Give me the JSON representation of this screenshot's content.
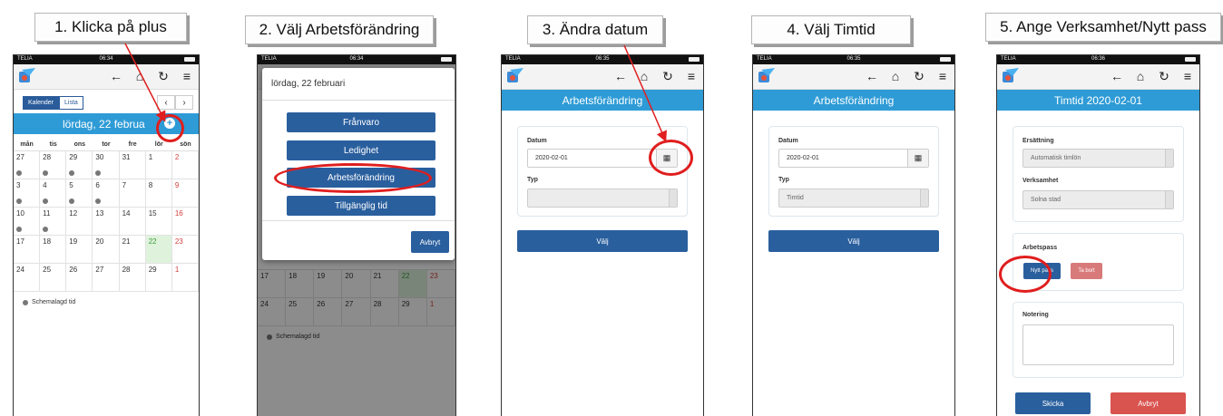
{
  "captions": [
    "1. Klicka på plus",
    "2. Välj Arbetsförändring",
    "3. Ändra datum",
    "4. Välj Timtid",
    "5. Ange Verksamhet/Nytt pass"
  ],
  "status": {
    "carrier": "TELIA",
    "times": [
      "06:34",
      "06:34",
      "06:35",
      "06:35",
      "06:36"
    ]
  },
  "nav_icons": {
    "back": "←",
    "home": "⌂",
    "refresh": "↻",
    "menu": "≡"
  },
  "screen1": {
    "view_tabs": [
      "Kalender",
      "Lista"
    ],
    "prev": "‹",
    "next": "›",
    "date_header": "lördag, 22 februa",
    "plus": "+",
    "weekdays": [
      "mån",
      "tis",
      "ons",
      "tor",
      "fre",
      "lör",
      "sön"
    ],
    "weeks": [
      [
        "27",
        "28",
        "29",
        "30",
        "31",
        "1",
        "2"
      ],
      [
        "3",
        "4",
        "5",
        "6",
        "7",
        "8",
        "9"
      ],
      [
        "10",
        "11",
        "12",
        "13",
        "14",
        "15",
        "16"
      ],
      [
        "17",
        "18",
        "19",
        "20",
        "21",
        "22",
        "23"
      ],
      [
        "24",
        "25",
        "26",
        "27",
        "28",
        "29",
        "1"
      ]
    ],
    "legend": "Schemalagd tid"
  },
  "screen2": {
    "dialog_title": "lördag, 22 februari",
    "options": [
      "Frånvaro",
      "Ledighet",
      "Arbetsförändring",
      "Tillgänglig tid"
    ],
    "cancel": "Avbryt",
    "bg_weeks": [
      [
        "17",
        "18",
        "19",
        "20",
        "21",
        "22",
        "23"
      ],
      [
        "24",
        "25",
        "26",
        "27",
        "28",
        "29",
        "1"
      ]
    ],
    "legend": "Schemalagd tid"
  },
  "screen3": {
    "header": "Arbetsförändring",
    "date_label": "Datum",
    "date_value": "2020-02-01",
    "type_label": "Typ",
    "type_value": "",
    "select": "Välj"
  },
  "screen4": {
    "header": "Arbetsförändring",
    "date_label": "Datum",
    "date_value": "2020-02-01",
    "type_label": "Typ",
    "type_value": "Timtid",
    "select": "Välj"
  },
  "screen5": {
    "header": "Timtid 2020-02-01",
    "comp_label": "Ersättning",
    "comp_value": "Automatisk timlön",
    "org_label": "Verksamhet",
    "org_value": "Solna stad",
    "shift_label": "Arbetspass",
    "new_shift": "Nytt pass",
    "remove": "Ta bort",
    "note_label": "Notering",
    "send": "Skicka",
    "cancel": "Avbryt"
  },
  "colors": {
    "header_blue": "#2e9bd6",
    "button_blue": "#2a5f9e",
    "highlight_red": "#e01e1e",
    "danger": "#d9534f",
    "remove": "#d97a7a"
  }
}
